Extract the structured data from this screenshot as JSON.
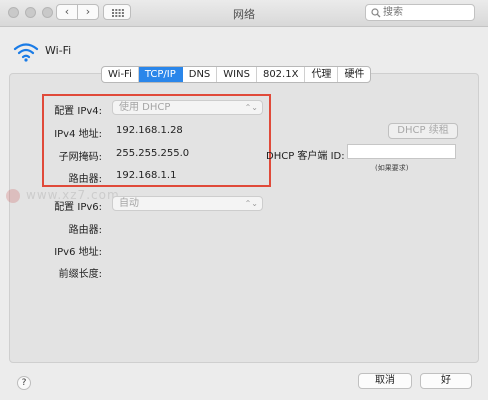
{
  "window": {
    "title": "网络"
  },
  "search": {
    "placeholder": "搜索"
  },
  "nav": {
    "back": "‹",
    "forward": "›"
  },
  "interface": {
    "name": "Wi-Fi"
  },
  "tabs": [
    {
      "label": "Wi-Fi",
      "active": false
    },
    {
      "label": "TCP/IP",
      "active": true
    },
    {
      "label": "DNS",
      "active": false
    },
    {
      "label": "WINS",
      "active": false
    },
    {
      "label": "802.1X",
      "active": false
    },
    {
      "label": "代理",
      "active": false
    },
    {
      "label": "硬件",
      "active": false
    }
  ],
  "ipv4": {
    "configure_label": "配置 IPv4:",
    "configure_value": "使用 DHCP",
    "address_label": "IPv4 地址:",
    "address_value": "192.168.1.28",
    "subnet_label": "子网掩码:",
    "subnet_value": "255.255.255.0",
    "router_label": "路由器:",
    "router_value": "192.168.1.1"
  },
  "dhcp": {
    "renew_button": "DHCP 续租",
    "client_id_label": "DHCP 客户端 ID:",
    "client_id_value": "",
    "hint": "(如果要求)"
  },
  "ipv6": {
    "configure_label": "配置 IPv6:",
    "configure_value": "自动",
    "router_label": "路由器:",
    "address_label": "IPv6 地址:",
    "prefix_label": "前缀长度:"
  },
  "footer": {
    "help": "?",
    "cancel": "取消",
    "ok": "好"
  },
  "watermark": {
    "text": "www.xz7.com"
  },
  "colors": {
    "accent": "#2a86ea",
    "highlight_box": "#e04a3a"
  }
}
